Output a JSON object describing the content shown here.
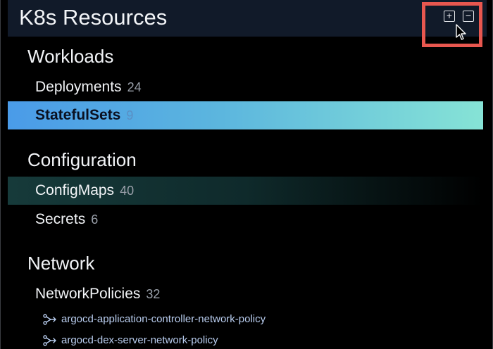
{
  "header": {
    "title": "K8s Resources",
    "expand_label": "+",
    "collapse_label": "−"
  },
  "sections": [
    {
      "title": "Workloads",
      "items": [
        {
          "label": "Deployments",
          "count": "24",
          "state": "normal"
        },
        {
          "label": "StatefulSets",
          "count": "9",
          "state": "selected"
        }
      ]
    },
    {
      "title": "Configuration",
      "items": [
        {
          "label": "ConfigMaps",
          "count": "40",
          "state": "hover"
        },
        {
          "label": "Secrets",
          "count": "6",
          "state": "normal"
        }
      ]
    },
    {
      "title": "Network",
      "items": [
        {
          "label": "NetworkPolicies",
          "count": "32",
          "state": "expanded"
        }
      ],
      "children": [
        {
          "label": "argocd-application-controller-network-policy",
          "icon": "network-policy-icon"
        },
        {
          "label": "argocd-dex-server-network-policy",
          "icon": "network-policy-icon"
        }
      ]
    }
  ],
  "colors": {
    "header_bg": "#111a29",
    "selected_start": "#4a9be8",
    "selected_end": "#86e3d6",
    "hover_bg": "#163a3a",
    "highlight": "#e8574f"
  }
}
